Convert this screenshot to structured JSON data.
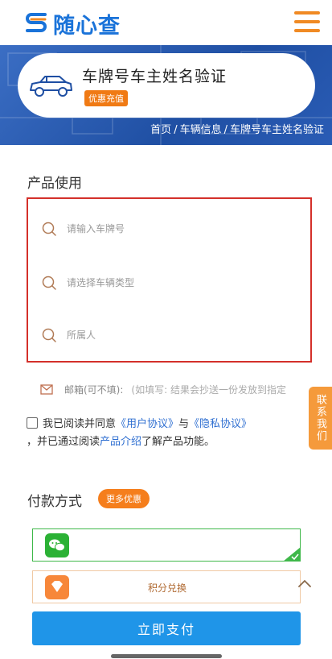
{
  "header": {
    "logo_text": "随心查",
    "logo_icon": "s-logo-icon",
    "menu_icon": "hamburger-menu-icon"
  },
  "banner": {
    "title": "车牌号车主姓名验证",
    "promo_badge": "优惠充值",
    "car_icon": "car-outline-icon",
    "breadcrumb": [
      "首页",
      "车辆信息",
      "车牌号车主姓名验证"
    ]
  },
  "product": {
    "section_title": "产品使用",
    "fields": [
      {
        "placeholder": "请输入车牌号",
        "value": ""
      },
      {
        "placeholder": "请选择车辆类型",
        "value": ""
      },
      {
        "placeholder": "所属人",
        "value": ""
      }
    ],
    "email_label": "邮箱(可不填):",
    "email_hint": "(如填写: 结果会抄送一份发放到指定",
    "side_contact": "联系我们"
  },
  "agreement": {
    "prefix": "我已阅读并同意",
    "user_agreement": "《用户协议》",
    "and": "与",
    "privacy_agreement": "《隐私协议》",
    "line2_prefix": "，并已通过阅读",
    "product_intro": "产品介绍",
    "line2_suffix": "了解产品功能。",
    "checked": false
  },
  "payment": {
    "section_title": "付款方式",
    "more_badge": "更多优惠",
    "options": [
      {
        "icon": "wechat-pay-icon",
        "label": "",
        "selected": true
      },
      {
        "icon": "diamond-points-icon",
        "label": "积分兑换",
        "selected": false
      }
    ],
    "pay_button": "立即支付"
  },
  "colors": {
    "brand_blue": "#1a73d9",
    "accent_orange": "#f08a24",
    "highlight_red": "#d4302a",
    "wechat_green": "#2bb135",
    "pay_button": "#1f95e8"
  }
}
